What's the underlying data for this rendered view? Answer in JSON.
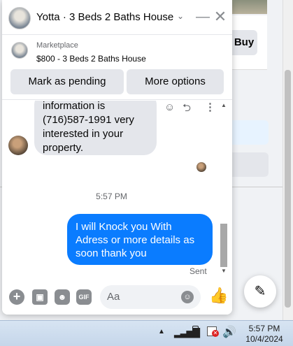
{
  "background": {
    "buy_label": "Buy"
  },
  "chat": {
    "title": "Yotta · 3 Beds 2 Baths House",
    "listing": {
      "kind": "Marketplace",
      "title": "$800 - 3 Beds 2 Baths House",
      "mark_pending_label": "Mark as pending",
      "more_options_label": "More options"
    },
    "incoming_message": "information is (716)587-1991 very interested in your property.",
    "timestamp": "5:57 PM",
    "outgoing_message": "I will Knock you With Adress or more details  as soon thank you",
    "status": "Sent",
    "composer": {
      "placeholder": "Aa"
    }
  },
  "taskbar": {
    "time": "5:57 PM",
    "date": "10/4/2024"
  },
  "colors": {
    "outgoing_bubble": "#0a7cff",
    "incoming_bubble": "#e4e6eb",
    "taskbar": "#c5d6ea"
  }
}
